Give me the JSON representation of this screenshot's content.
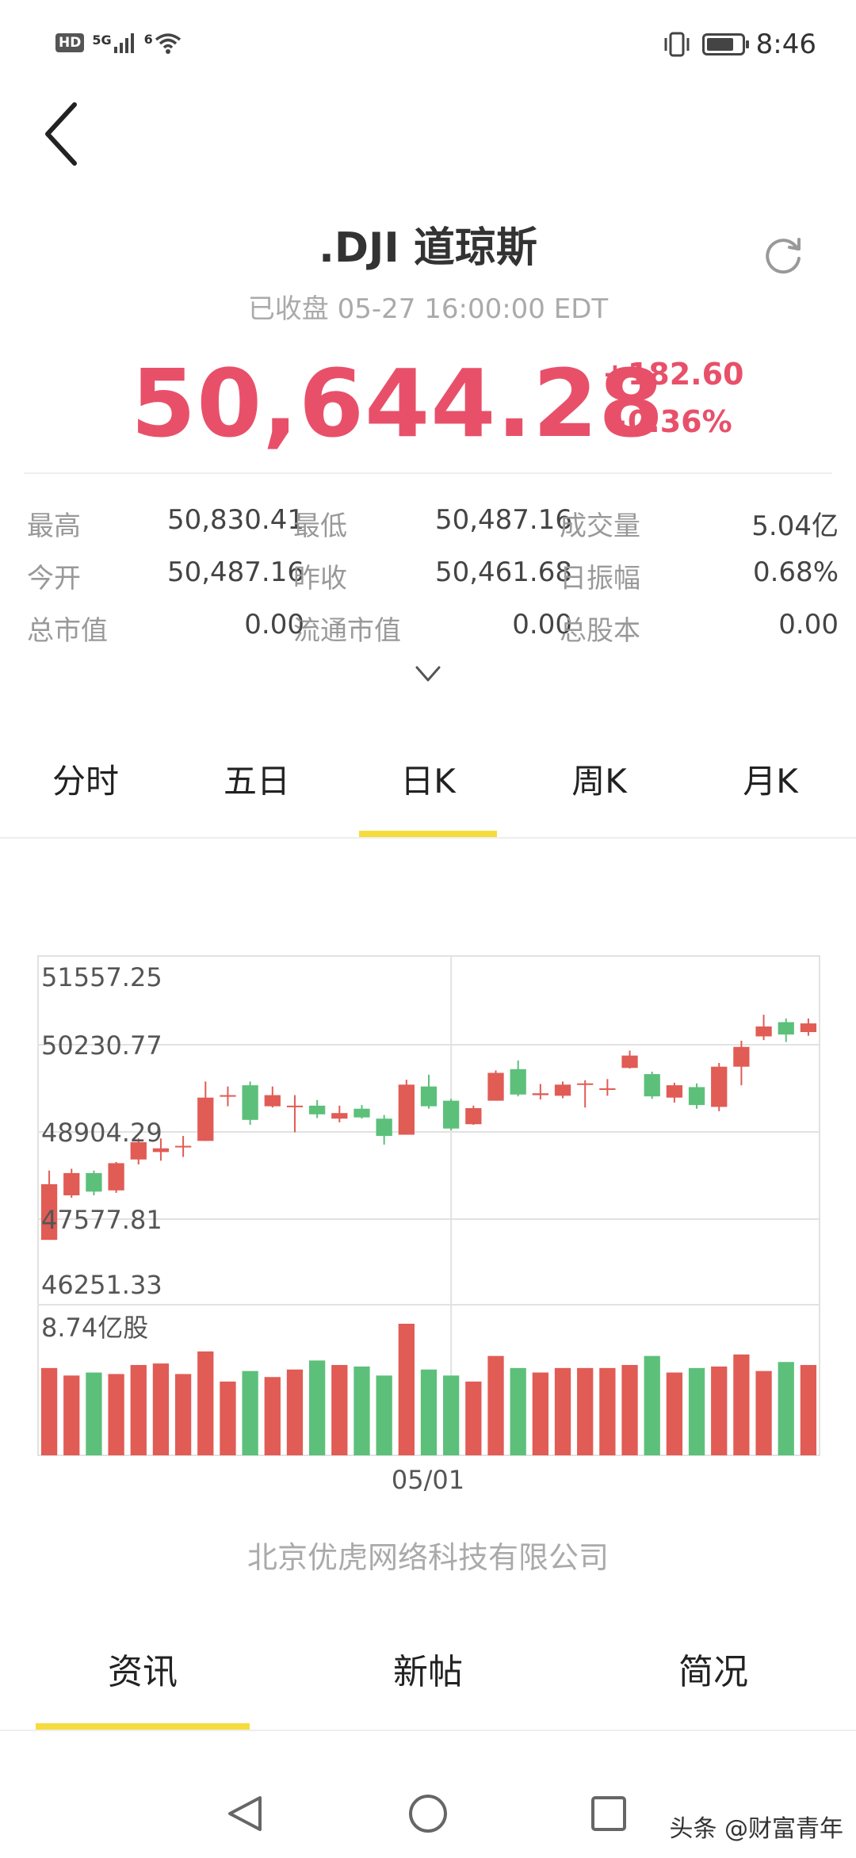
{
  "status_bar": {
    "hd": "HD",
    "network": "5G",
    "wifi_sub": "6",
    "battery_level": 0.8,
    "time": "8:46"
  },
  "header": {
    "title": ".DJI 道琼斯",
    "subtitle": "已收盘 05-27 16:00:00 EDT"
  },
  "quote": {
    "price": "50,644.28",
    "change": "+182.60",
    "change_pct": "+0.36%",
    "up_color": "#e8506a"
  },
  "stats": [
    [
      {
        "label": "最高",
        "value": "50,830.41"
      },
      {
        "label": "最低",
        "value": "50,487.16"
      },
      {
        "label": "成交量",
        "value": "5.04亿"
      }
    ],
    [
      {
        "label": "今开",
        "value": "50,487.16"
      },
      {
        "label": "昨收",
        "value": "50,461.68"
      },
      {
        "label": "日振幅",
        "value": "0.68%"
      }
    ],
    [
      {
        "label": "总市值",
        "value": "0.00"
      },
      {
        "label": "流通市值",
        "value": "0.00"
      },
      {
        "label": "总股本",
        "value": "0.00"
      }
    ]
  ],
  "period_tabs": [
    {
      "label": "分时",
      "active": false
    },
    {
      "label": "五日",
      "active": false
    },
    {
      "label": "日K",
      "active": true
    },
    {
      "label": "周K",
      "active": false
    },
    {
      "label": "月K",
      "active": false
    }
  ],
  "chart_data": {
    "type": "candlestick",
    "y_ticks": [
      "51557.25",
      "50230.77",
      "48904.29",
      "47577.81",
      "46251.33"
    ],
    "ylim": [
      46251.33,
      51557.25
    ],
    "volume_label": "8.74亿股",
    "volume_max": 8.74,
    "x_tick": "05/01",
    "x_tick_index": 18,
    "colors": {
      "up": "#e05c55",
      "down": "#5cc07a"
    },
    "candles": [
      {
        "o": 47300,
        "c": 48200,
        "h": 48420,
        "l": 47300,
        "v": 5.8
      },
      {
        "o": 48020,
        "c": 48380,
        "h": 48450,
        "l": 47980,
        "v": 5.3
      },
      {
        "o": 48380,
        "c": 48080,
        "h": 48420,
        "l": 48020,
        "v": 5.5
      },
      {
        "o": 48100,
        "c": 48540,
        "h": 48560,
        "l": 48060,
        "v": 5.4
      },
      {
        "o": 48600,
        "c": 48880,
        "h": 48940,
        "l": 48520,
        "v": 6.0
      },
      {
        "o": 48720,
        "c": 48780,
        "h": 48940,
        "l": 48580,
        "v": 6.1
      },
      {
        "o": 48800,
        "c": 48820,
        "h": 48980,
        "l": 48640,
        "v": 5.4
      },
      {
        "o": 48900,
        "c": 49600,
        "h": 49860,
        "l": 48900,
        "v": 6.9
      },
      {
        "o": 49620,
        "c": 49640,
        "h": 49780,
        "l": 49460,
        "v": 4.9
      },
      {
        "o": 49800,
        "c": 49240,
        "h": 49860,
        "l": 49160,
        "v": 5.6
      },
      {
        "o": 49460,
        "c": 49640,
        "h": 49780,
        "l": 49440,
        "v": 5.2
      },
      {
        "o": 49450,
        "c": 49470,
        "h": 49640,
        "l": 49040,
        "v": 5.7
      },
      {
        "o": 49470,
        "c": 49330,
        "h": 49560,
        "l": 49270,
        "v": 6.3
      },
      {
        "o": 49260,
        "c": 49350,
        "h": 49470,
        "l": 49200,
        "v": 6.0
      },
      {
        "o": 49420,
        "c": 49280,
        "h": 49480,
        "l": 49260,
        "v": 5.9
      },
      {
        "o": 49260,
        "c": 48980,
        "h": 49320,
        "l": 48840,
        "v": 5.3
      },
      {
        "o": 49000,
        "c": 49810,
        "h": 49890,
        "l": 49000,
        "v": 8.74
      },
      {
        "o": 49780,
        "c": 49460,
        "h": 49970,
        "l": 49420,
        "v": 5.7
      },
      {
        "o": 49550,
        "c": 49100,
        "h": 49580,
        "l": 49070,
        "v": 5.3
      },
      {
        "o": 49170,
        "c": 49430,
        "h": 49470,
        "l": 49160,
        "v": 4.9
      },
      {
        "o": 49550,
        "c": 50000,
        "h": 50040,
        "l": 49550,
        "v": 6.6
      },
      {
        "o": 50060,
        "c": 49650,
        "h": 50200,
        "l": 49620,
        "v": 5.8
      },
      {
        "o": 49640,
        "c": 49670,
        "h": 49820,
        "l": 49570,
        "v": 5.5
      },
      {
        "o": 49630,
        "c": 49810,
        "h": 49860,
        "l": 49590,
        "v": 5.8
      },
      {
        "o": 49820,
        "c": 49830,
        "h": 49880,
        "l": 49440,
        "v": 5.8
      },
      {
        "o": 49730,
        "c": 49750,
        "h": 49900,
        "l": 49630,
        "v": 5.8
      },
      {
        "o": 50080,
        "c": 50280,
        "h": 50360,
        "l": 50070,
        "v": 6.0
      },
      {
        "o": 49980,
        "c": 49620,
        "h": 50020,
        "l": 49580,
        "v": 6.6
      },
      {
        "o": 49600,
        "c": 49800,
        "h": 49840,
        "l": 49520,
        "v": 5.5
      },
      {
        "o": 49770,
        "c": 49480,
        "h": 49830,
        "l": 49420,
        "v": 5.8
      },
      {
        "o": 49450,
        "c": 50100,
        "h": 50160,
        "l": 49380,
        "v": 5.9
      },
      {
        "o": 50100,
        "c": 50420,
        "h": 50520,
        "l": 49800,
        "v": 6.7
      },
      {
        "o": 50590,
        "c": 50750,
        "h": 50940,
        "l": 50530,
        "v": 5.6
      },
      {
        "o": 50820,
        "c": 50620,
        "h": 50880,
        "l": 50500,
        "v": 6.2
      },
      {
        "o": 50660,
        "c": 50800,
        "h": 50880,
        "l": 50600,
        "v": 6.0
      }
    ]
  },
  "company": "北京优虎网络科技有限公司",
  "bottom_tabs": [
    {
      "label": "资讯",
      "active": true
    },
    {
      "label": "新帖",
      "active": false
    },
    {
      "label": "简况",
      "active": false
    }
  ],
  "watermark": "头条 @财富青年"
}
